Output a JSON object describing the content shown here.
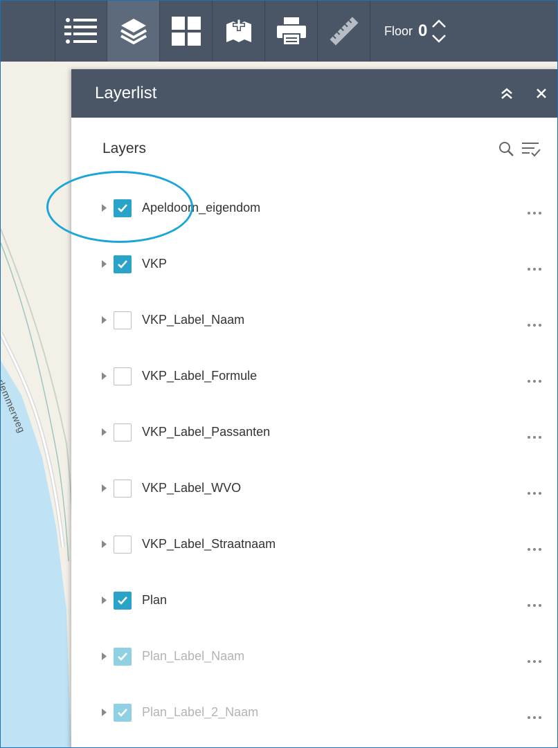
{
  "toolbar": {
    "tools": [
      "list-icon",
      "layers-icon",
      "grid-icon",
      "map-add-icon",
      "print-icon",
      "ruler-icon"
    ],
    "floor_label": "Floor",
    "floor_value": "0"
  },
  "map": {
    "street_label": "Haarlemmerweg"
  },
  "panel": {
    "title": "Layerlist",
    "layers_heading": "Layers",
    "layers": [
      {
        "name": "Apeldoorn_eigendom",
        "checked": true,
        "dim": false
      },
      {
        "name": "VKP",
        "checked": true,
        "dim": false
      },
      {
        "name": "VKP_Label_Naam",
        "checked": false,
        "dim": false
      },
      {
        "name": "VKP_Label_Formule",
        "checked": false,
        "dim": false
      },
      {
        "name": "VKP_Label_Passanten",
        "checked": false,
        "dim": false
      },
      {
        "name": "VKP_Label_WVO",
        "checked": false,
        "dim": false
      },
      {
        "name": "VKP_Label_Straatnaam",
        "checked": false,
        "dim": false
      },
      {
        "name": "Plan",
        "checked": true,
        "dim": false
      },
      {
        "name": "Plan_Label_Naam",
        "checked": true,
        "dim": true
      },
      {
        "name": "Plan_Label_2_Naam",
        "checked": true,
        "dim": true
      }
    ]
  },
  "colors": {
    "toolbar_bg": "#4a5566",
    "checkbox_checked": "#2aa3c8",
    "annotation": "#1aa6d8"
  }
}
